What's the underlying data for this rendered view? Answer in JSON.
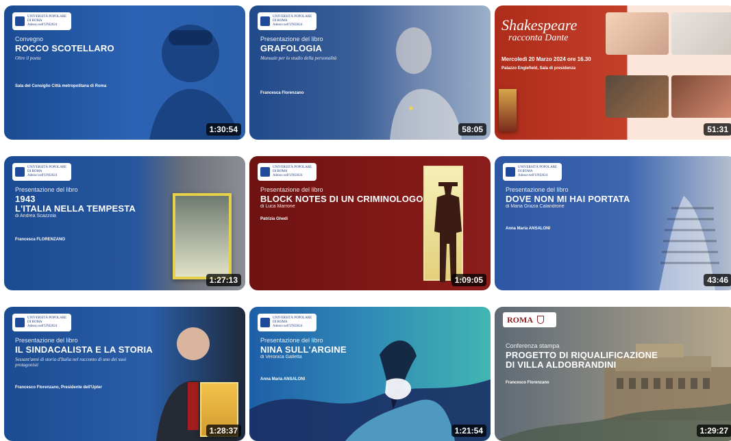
{
  "videos": [
    {
      "kicker": "Convegno",
      "title": "ROCCO SCOTELLARO",
      "subtitle": "Oltre il poeta",
      "details": "Sala del Consiglio Città metropolitana di Roma",
      "duration": "1:30:54",
      "logo_line1": "UNIVERSITÀ POPOLARE",
      "logo_line2": "DI ROMA",
      "logo_line3": "Adesso nell'UNI2024",
      "watched_pct": 0.0,
      "color_primary": "#1c4d96",
      "color_secondary": "#2f6ac2"
    },
    {
      "kicker": "Presentazione del libro",
      "title": "GRAFOLOGIA",
      "subtitle": "Manuale per lo studio della personalità",
      "details": "Francesca Florenzano",
      "duration": "58:05",
      "logo_line1": "UNIVERSITÀ POPOLARE",
      "logo_line2": "DI ROMA",
      "logo_line3": "Adesso nell'UNI2024",
      "watched_pct": 0.0,
      "color_primary": "#1f468c",
      "color_secondary": "#6d86b1"
    },
    {
      "kicker": "Shakespeare",
      "title": "racconta Dante",
      "subtitle": "Mercoledì 20 Marzo 2024 ore 16.30",
      "details": "Palazzo Englefield, Sala di presidenza",
      "duration": "51:31",
      "watched_pct": 0.0,
      "color_primary": "#b2321e",
      "color_secondary": "#f4b18a"
    },
    {
      "kicker": "Presentazione del libro",
      "title": "1943",
      "title2": "L'ITALIA NELLA TEMPESTA",
      "subtitle": "di Andrea Scazzola",
      "details": "Francesca FLORENZANO",
      "duration": "1:27:13",
      "logo_line1": "UNIVERSITÀ POPOLARE",
      "logo_line2": "DI ROMA",
      "logo_line3": "Adesso nell'UNI2024",
      "watched_pct": 0.0,
      "color_primary": "#1c4d96",
      "color_secondary": "#7a7f88"
    },
    {
      "kicker": "Presentazione del libro",
      "title": "BLOCK NOTES DI UN CRIMINOLOGO",
      "subtitle": "di Luca Marrone",
      "details": "Patrizia Ghedi",
      "duration": "1:09:05",
      "logo_line1": "UNIVERSITÀ POPOLARE",
      "logo_line2": "DI ROMA",
      "logo_line3": "Adesso nell'UNI2024",
      "watched_pct": 0.0,
      "color_primary": "#7d1616",
      "color_secondary": "#f2e4a6"
    },
    {
      "kicker": "Presentazione del libro",
      "title": "DOVE NON MI HAI PORTATA",
      "subtitle": "di Maria Grazia Calandrone",
      "details": "Anna Maria ANSALONI",
      "duration": "43:46",
      "logo_line1": "UNIVERSITÀ POPOLARE",
      "logo_line2": "DI ROMA",
      "logo_line3": "Adesso nell'UNI2024",
      "watched_pct": 0.0,
      "color_primary": "#2d56a3",
      "color_secondary": "#a6b0c1"
    },
    {
      "kicker": "Presentazione del libro",
      "title": "IL SINDACALISTA E LA STORIA",
      "subtitle": "Sessant'anni di storia d'Italia nel racconto di uno dei suoi protagonisti",
      "details": "Francesco Florenzano, Presidente dell'Upter",
      "duration": "1:28:37",
      "logo_line1": "UNIVERSITÀ POPOLARE",
      "logo_line2": "DI ROMA",
      "logo_line3": "Adesso nell'UNI2024",
      "watched_pct": 0.0,
      "color_primary": "#1c4d96",
      "color_secondary": "#2e2e3a"
    },
    {
      "kicker": "Presentazione del libro",
      "title": "NINA SULL'ARGINE",
      "subtitle": "di Veronica Galletta",
      "details": "Anna Maria ANSALONI",
      "duration": "1:21:54",
      "logo_line1": "UNIVERSITÀ POPOLARE",
      "logo_line2": "DI ROMA",
      "logo_line3": "Adesso nell'UNI2024",
      "watched_pct": 0.0,
      "color_primary": "#1e5fa8",
      "color_secondary": "#41b6b2"
    },
    {
      "kicker": "Conferenza stampa",
      "title": "PROGETTO DI RIQUALIFICAZIONE",
      "title2": "DI VILLA ALDOBRANDINI",
      "subtitle": "",
      "details": "Francesco Florenzano",
      "duration": "1:29:27",
      "brand": "ROMA",
      "watched_pct": 0.0,
      "color_primary": "#6b6a61",
      "color_secondary": "#b7a98d"
    }
  ]
}
